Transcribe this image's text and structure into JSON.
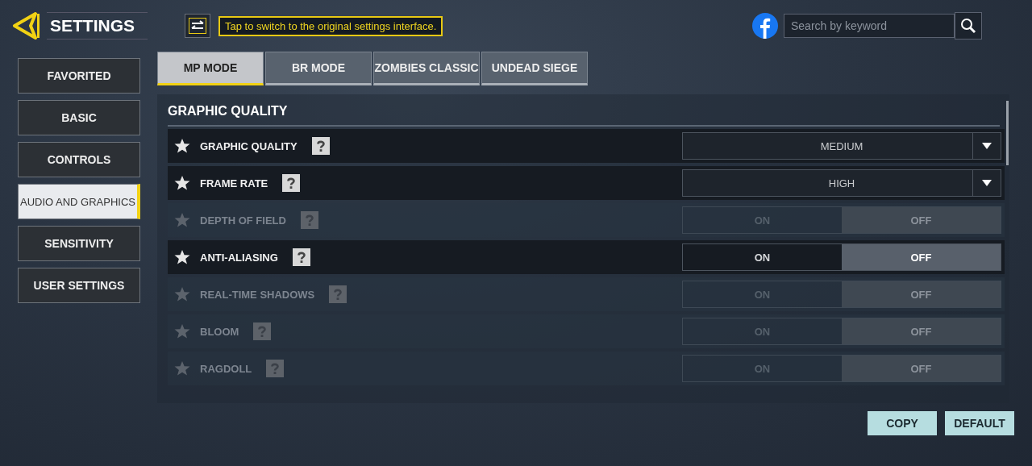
{
  "header": {
    "title": "SETTINGS",
    "tooltip": "Tap to switch to the original settings interface."
  },
  "search": {
    "placeholder": "Search by keyword"
  },
  "sidebar": {
    "items": [
      {
        "label": "FAVORITED",
        "selected": false
      },
      {
        "label": "BASIC",
        "selected": false
      },
      {
        "label": "CONTROLS",
        "selected": false
      },
      {
        "label": "AUDIO AND GRAPHICS",
        "selected": true
      },
      {
        "label": "SENSITIVITY",
        "selected": false
      },
      {
        "label": "USER SETTINGS",
        "selected": false
      }
    ]
  },
  "tabs": [
    {
      "label": "MP MODE",
      "selected": true
    },
    {
      "label": "BR MODE",
      "selected": false
    },
    {
      "label": "ZOMBIES CLASSIC",
      "selected": false
    },
    {
      "label": "UNDEAD SIEGE",
      "selected": false
    }
  ],
  "section": {
    "title": "GRAPHIC QUALITY",
    "rows": [
      {
        "label": "GRAPHIC QUALITY",
        "kind": "dropdown",
        "disabled": false,
        "value": "MEDIUM"
      },
      {
        "label": "FRAME RATE",
        "kind": "dropdown",
        "disabled": false,
        "value": "HIGH"
      },
      {
        "label": "DEPTH OF FIELD",
        "kind": "toggle",
        "disabled": true,
        "options": [
          {
            "label": "ON",
            "selected": false
          },
          {
            "label": "OFF",
            "selected": true
          }
        ]
      },
      {
        "label": "ANTI-ALIASING",
        "kind": "toggle",
        "disabled": false,
        "options": [
          {
            "label": "ON",
            "selected": false
          },
          {
            "label": "OFF",
            "selected": true
          }
        ]
      },
      {
        "label": "REAL-TIME SHADOWS",
        "kind": "toggle",
        "disabled": true,
        "options": [
          {
            "label": "ON",
            "selected": false
          },
          {
            "label": "OFF",
            "selected": true
          }
        ]
      },
      {
        "label": "BLOOM",
        "kind": "toggle",
        "disabled": true,
        "options": [
          {
            "label": "ON",
            "selected": false
          },
          {
            "label": "OFF",
            "selected": true
          }
        ]
      },
      {
        "label": "RAGDOLL",
        "kind": "toggle",
        "disabled": true,
        "options": [
          {
            "label": "ON",
            "selected": false
          },
          {
            "label": "OFF",
            "selected": true
          }
        ]
      }
    ]
  },
  "footer": {
    "buttons": [
      "COPY",
      "DEFAULT"
    ]
  }
}
